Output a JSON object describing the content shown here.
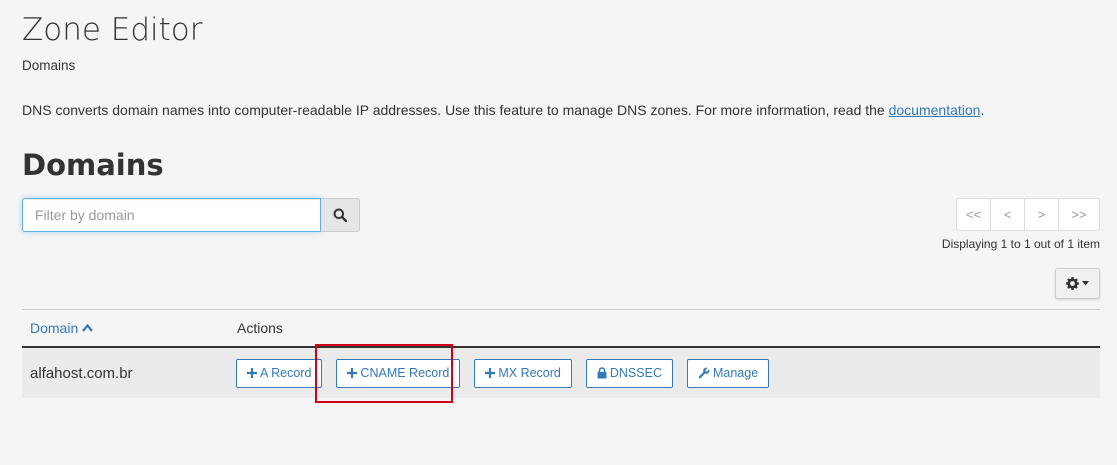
{
  "header": {
    "title": "Zone Editor",
    "breadcrumb": "Domains"
  },
  "description": {
    "text": "DNS converts domain names into computer-readable IP addresses. Use this feature to manage DNS zones. For more information, read the ",
    "link": "documentation",
    "suffix": "."
  },
  "section": {
    "title": "Domains"
  },
  "search": {
    "placeholder": "Filter by domain",
    "icon": "search-icon"
  },
  "pagination": {
    "first": "<<",
    "prev": "<",
    "next": ">",
    "last": ">>",
    "status": "Displaying 1 to 1 out of 1 item"
  },
  "settings": {
    "icon": "gear-icon"
  },
  "table": {
    "headers": {
      "domain": "Domain",
      "actions": "Actions"
    },
    "rows": [
      {
        "domain": "alfahost.com.br",
        "actions": [
          {
            "label": "A Record",
            "icon": "plus-icon"
          },
          {
            "label": "CNAME Record",
            "icon": "plus-icon"
          },
          {
            "label": "MX Record",
            "icon": "plus-icon"
          },
          {
            "label": "DNSSEC",
            "icon": "lock-icon"
          },
          {
            "label": "Manage",
            "icon": "wrench-icon"
          }
        ]
      }
    ]
  },
  "colors": {
    "link": "#337ab7",
    "highlight": "#d0021b"
  }
}
